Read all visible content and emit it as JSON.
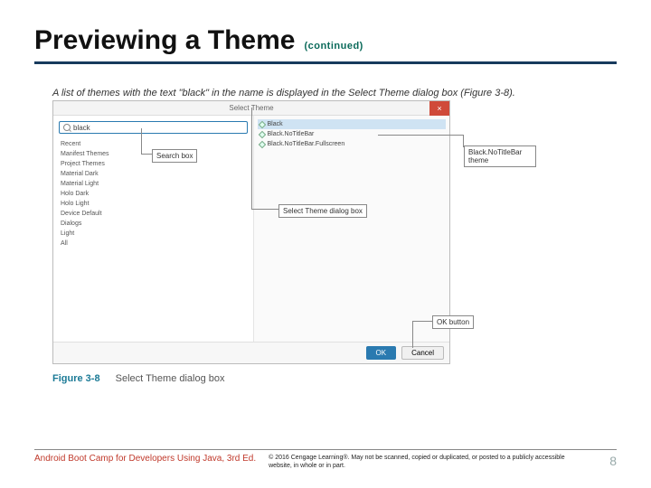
{
  "title": "Previewing a Theme",
  "subtitle": "(continued)",
  "lead_caption": "A list of themes with the text \"black\" in the name is displayed in the Select Theme dialog box (Figure 3-8).",
  "dialog": {
    "title": "Select Theme",
    "close": "×",
    "search_value": "black",
    "left_items": [
      "Recent",
      "Manifest Themes",
      "Project Themes",
      "Material Dark",
      "Material Light",
      "Holo Dark",
      "Holo Light",
      "Device Default",
      "Dialogs",
      "Light",
      "All"
    ],
    "right_items": [
      "Black",
      "Black.NoTitleBar",
      "Black.NoTitleBar.Fullscreen"
    ],
    "ok": "OK",
    "cancel": "Cancel"
  },
  "callouts": {
    "search": "Search box",
    "select_theme": "Select Theme dialog box",
    "right_theme": "Black.NoTitleBar theme",
    "ok_button": "OK button"
  },
  "figure": {
    "num": "Figure 3-8",
    "text": "Select Theme dialog box"
  },
  "footer": {
    "book": "Android Boot Camp for Developers Using Java, 3rd Ed.",
    "copyright": "© 2016 Cengage Learning®. May not be scanned, copied or duplicated, or posted to a publicly accessible website, in whole or in part.",
    "page": "8"
  }
}
